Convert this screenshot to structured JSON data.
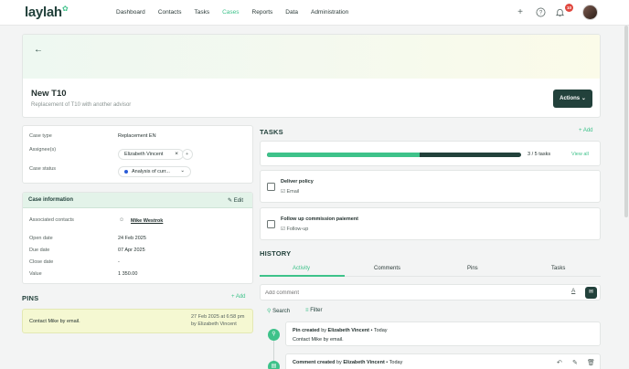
{
  "app": {
    "logo": "laylah"
  },
  "nav": {
    "items": [
      {
        "label": "Dashboard"
      },
      {
        "label": "Contacts"
      },
      {
        "label": "Tasks"
      },
      {
        "label": "Cases"
      },
      {
        "label": "Reports"
      },
      {
        "label": "Data"
      },
      {
        "label": "Administration"
      }
    ],
    "active": "Cases"
  },
  "topbar": {
    "notification_count": "10",
    "icons": [
      "plus-icon",
      "help-icon",
      "bell-icon"
    ]
  },
  "case": {
    "title": "New T10",
    "subtitle": "Replacement of T10 with another advisor",
    "actions_label": "Actions"
  },
  "details": {
    "case_type_label": "Case type",
    "case_type_value": "Replacement EN",
    "assignees_label": "Assignee(s)",
    "assignee": "Elizabeth Vincent",
    "case_status_label": "Case status",
    "case_status_value": "Analysis of curr..."
  },
  "case_info": {
    "title": "Case information",
    "edit_label": "Edit",
    "associated_contacts_label": "Associated contacts",
    "associated_contact": "Mike Westrok",
    "open_date_label": "Open date",
    "open_date": "24 Feb 2025",
    "due_date_label": "Due date",
    "due_date": "07 Apr 2025",
    "close_date_label": "Close date",
    "close_date": "-",
    "value_label": "Value",
    "value": "1 350.00"
  },
  "pins": {
    "title": "PINS",
    "add_label": "Add",
    "items": [
      {
        "text": "Contact Mike by email.",
        "date": "27 Feb 2025 at 6:58 pm",
        "author": "by Elizabeth Vincent"
      }
    ]
  },
  "tasks": {
    "title": "TASKS",
    "add_label": "Add",
    "progress_text": "3 / 5 tasks",
    "progress_fraction": 0.6,
    "view_all_label": "View all",
    "items": [
      {
        "title": "Deliver policy",
        "type": "Email"
      },
      {
        "title": "Follow up commission paiement",
        "type": "Follow-up"
      }
    ]
  },
  "history": {
    "title": "HISTORY",
    "tabs": [
      "Activity",
      "Comments",
      "Pins",
      "Tasks"
    ],
    "active_tab": "Activity",
    "comment_placeholder": "Add comment",
    "search_label": "Search",
    "filter_label": "Filter",
    "entries": [
      {
        "action": "Pin created",
        "by": "by",
        "author": "Elizabeth Vincent",
        "when": "Today",
        "text": "Contact Mike by email."
      },
      {
        "action": "Comment created",
        "by": "by",
        "author": "Elizabeth Vincent",
        "when": "Today"
      }
    ]
  },
  "colors": {
    "brand": "#22413b",
    "accent": "#3ec28a",
    "badge": "#e0473e",
    "pin_bg": "#f5f8d2"
  }
}
